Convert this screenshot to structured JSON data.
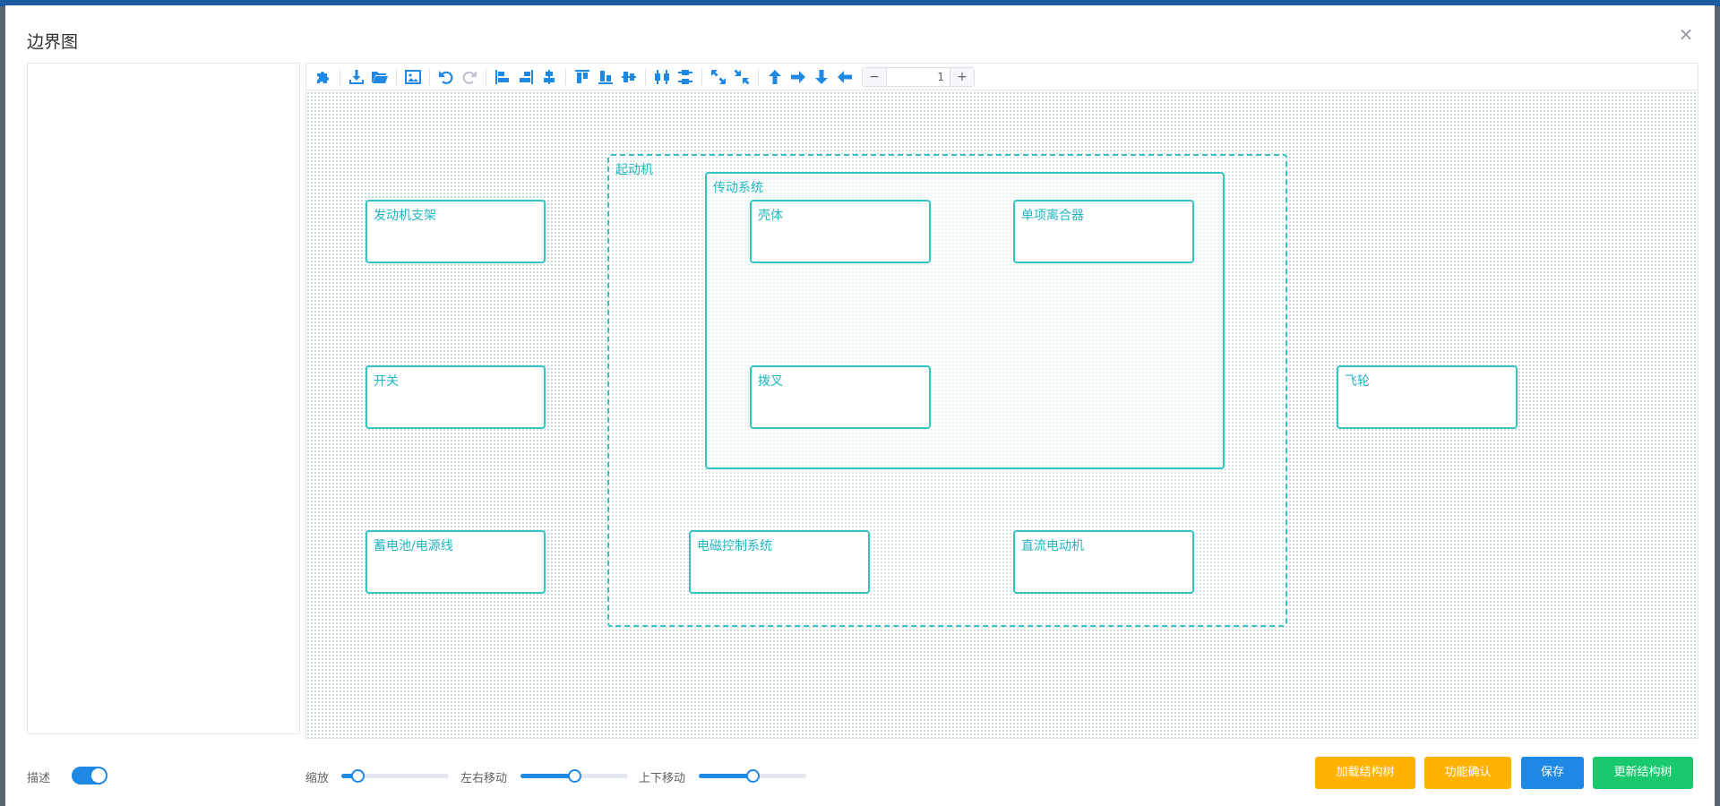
{
  "dialog": {
    "title": "边界图",
    "close_glyph": "×"
  },
  "toolbar": {
    "zoom_minus": "−",
    "zoom_value": "1",
    "zoom_plus": "+",
    "icons": [
      "puzzle-icon",
      "download-icon",
      "folder-open-icon",
      "image-icon",
      "undo-icon",
      "redo-icon",
      "align-left-icon",
      "align-right-icon",
      "align-center-icon",
      "align-top-icon",
      "align-bottom-icon",
      "align-middle-icon",
      "distribute-horizontal-icon",
      "distribute-vertical-icon",
      "expand-icon",
      "compress-icon",
      "arrow-up-icon",
      "arrow-right-icon",
      "arrow-down-icon",
      "arrow-left-icon"
    ]
  },
  "diagram": {
    "groups": {
      "starter": "起动机",
      "transmission": "传动系统"
    },
    "nodes": {
      "engine_mount": "发动机支架",
      "switch": "开关",
      "battery_cable": "蓄电池/电源线",
      "housing": "壳体",
      "one_way_clutch": "单项离合器",
      "shift_fork": "拨叉",
      "em_control": "电磁控制系统",
      "dc_motor": "直流电动机",
      "flywheel": "飞轮"
    }
  },
  "controls": {
    "describe_label": "描述",
    "describe_on": true,
    "zoom_label": "缩放",
    "zoom_level": 0.15,
    "horizontal_label": "左右移动",
    "horizontal_level": 0.5,
    "vertical_label": "上下移动",
    "vertical_level": 0.5
  },
  "buttons": {
    "load_tree": "加载结构树",
    "confirm_function": "功能确认",
    "save": "保存",
    "update_tree": "更新结构树"
  },
  "colors": {
    "accent_blue": "#1e88e5",
    "node_border": "#35c4c4",
    "node_text": "#1fb6c1",
    "load_tree_button": "#ffb300",
    "confirm_function_button": "#ffb300",
    "save_button": "#1e88e5",
    "update_tree_button": "#19c96d"
  }
}
